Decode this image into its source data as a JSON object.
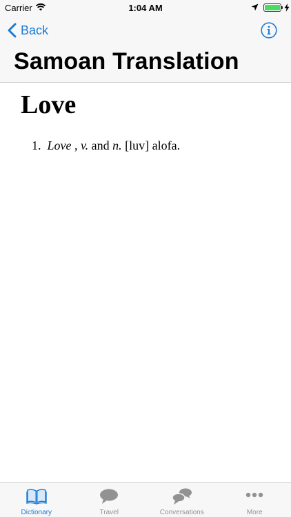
{
  "status_bar": {
    "carrier": "Carrier",
    "time": "1:04 AM",
    "battery_level": 1.0
  },
  "nav": {
    "back_label": "Back",
    "title": "Samoan Translation"
  },
  "entry": {
    "word": "Love",
    "definition": {
      "number": "1.",
      "headword": "Love",
      "separator": " ,",
      "pos1": "v.",
      "conjunction": "and",
      "pos2": "n.",
      "pronunciation": "[luv]",
      "translation": "alofa."
    }
  },
  "tabs": [
    {
      "label": "Dictionary",
      "icon": "book-icon",
      "active": true
    },
    {
      "label": "Travel",
      "icon": "speech-bubble-icon",
      "active": false
    },
    {
      "label": "Conversations",
      "icon": "conversation-bubbles-icon",
      "active": false
    },
    {
      "label": "More",
      "icon": "ellipsis-icon",
      "active": false
    }
  ],
  "colors": {
    "accent": "#1a7bd8",
    "inactive": "#929292",
    "battery": "#4cd964",
    "bar_background": "#f7f7f7"
  }
}
